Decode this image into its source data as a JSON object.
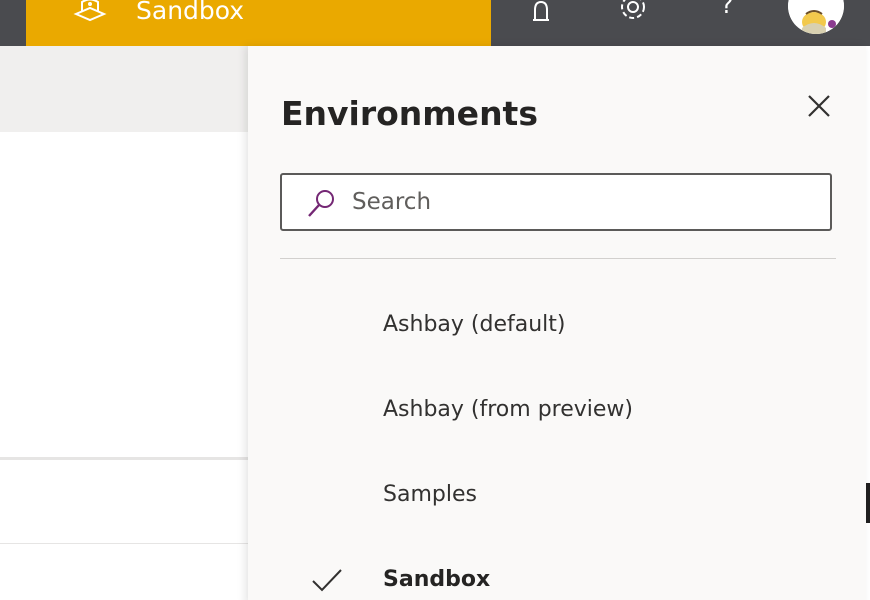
{
  "topbar": {
    "environment_name": "Sandbox",
    "help_glyph": "?",
    "icons": [
      "environment-icon",
      "bell-icon",
      "gear-icon",
      "help-icon",
      "avatar"
    ],
    "colors": {
      "bar": "#4a4b4f",
      "environment_badge": "#eaa900"
    }
  },
  "panel": {
    "title": "Environments",
    "search": {
      "placeholder": "Search",
      "value": ""
    },
    "environments": [
      {
        "label": "Ashbay (default)",
        "selected": false
      },
      {
        "label": "Ashbay (from preview)",
        "selected": false
      },
      {
        "label": "Samples",
        "selected": false
      },
      {
        "label": "Sandbox",
        "selected": true
      }
    ],
    "icons": [
      "close-icon",
      "search-icon",
      "checkmark-icon"
    ],
    "colors": {
      "search_icon": "#742774",
      "background": "#faf9f8"
    }
  }
}
